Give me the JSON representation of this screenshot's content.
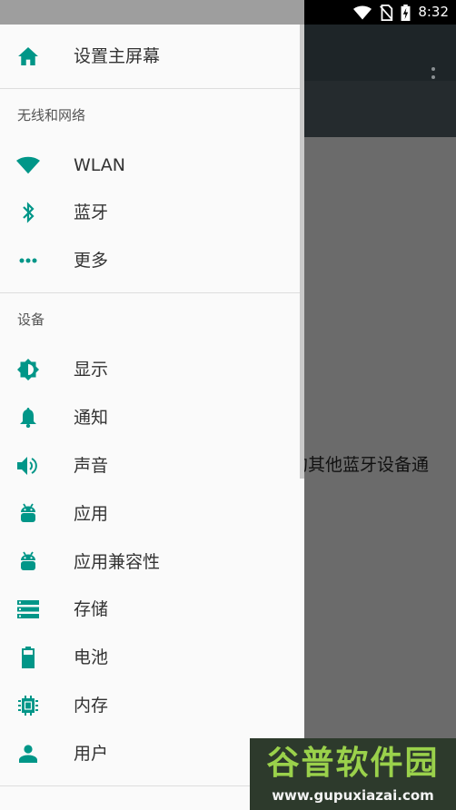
{
  "status_bar": {
    "time": "8:32"
  },
  "background": {
    "partial_text": "的其他蓝牙设备通"
  },
  "drawer": {
    "home": {
      "label": "设置主屏幕",
      "icon": "home-icon"
    },
    "sections": [
      {
        "header": "无线和网络",
        "items": [
          {
            "label": "WLAN",
            "icon": "wifi-icon"
          },
          {
            "label": "蓝牙",
            "icon": "bluetooth-icon"
          },
          {
            "label": "更多",
            "icon": "more-horiz-icon"
          }
        ]
      },
      {
        "header": "设备",
        "items": [
          {
            "label": "显示",
            "icon": "brightness-icon"
          },
          {
            "label": "通知",
            "icon": "bell-icon"
          },
          {
            "label": "声音",
            "icon": "volume-icon"
          },
          {
            "label": "应用",
            "icon": "android-icon"
          },
          {
            "label": "应用兼容性",
            "icon": "android-icon"
          },
          {
            "label": "存储",
            "icon": "storage-icon"
          },
          {
            "label": "电池",
            "icon": "battery-icon"
          },
          {
            "label": "内存",
            "icon": "memory-icon"
          },
          {
            "label": "用户",
            "icon": "person-icon"
          }
        ]
      }
    ]
  },
  "watermark": {
    "title": "谷普软件园",
    "url": "www.gupuxiazai.com"
  },
  "colors": {
    "accent": "#009688",
    "drawer_bg": "#fafafa",
    "toolbar": "#1e2528"
  }
}
